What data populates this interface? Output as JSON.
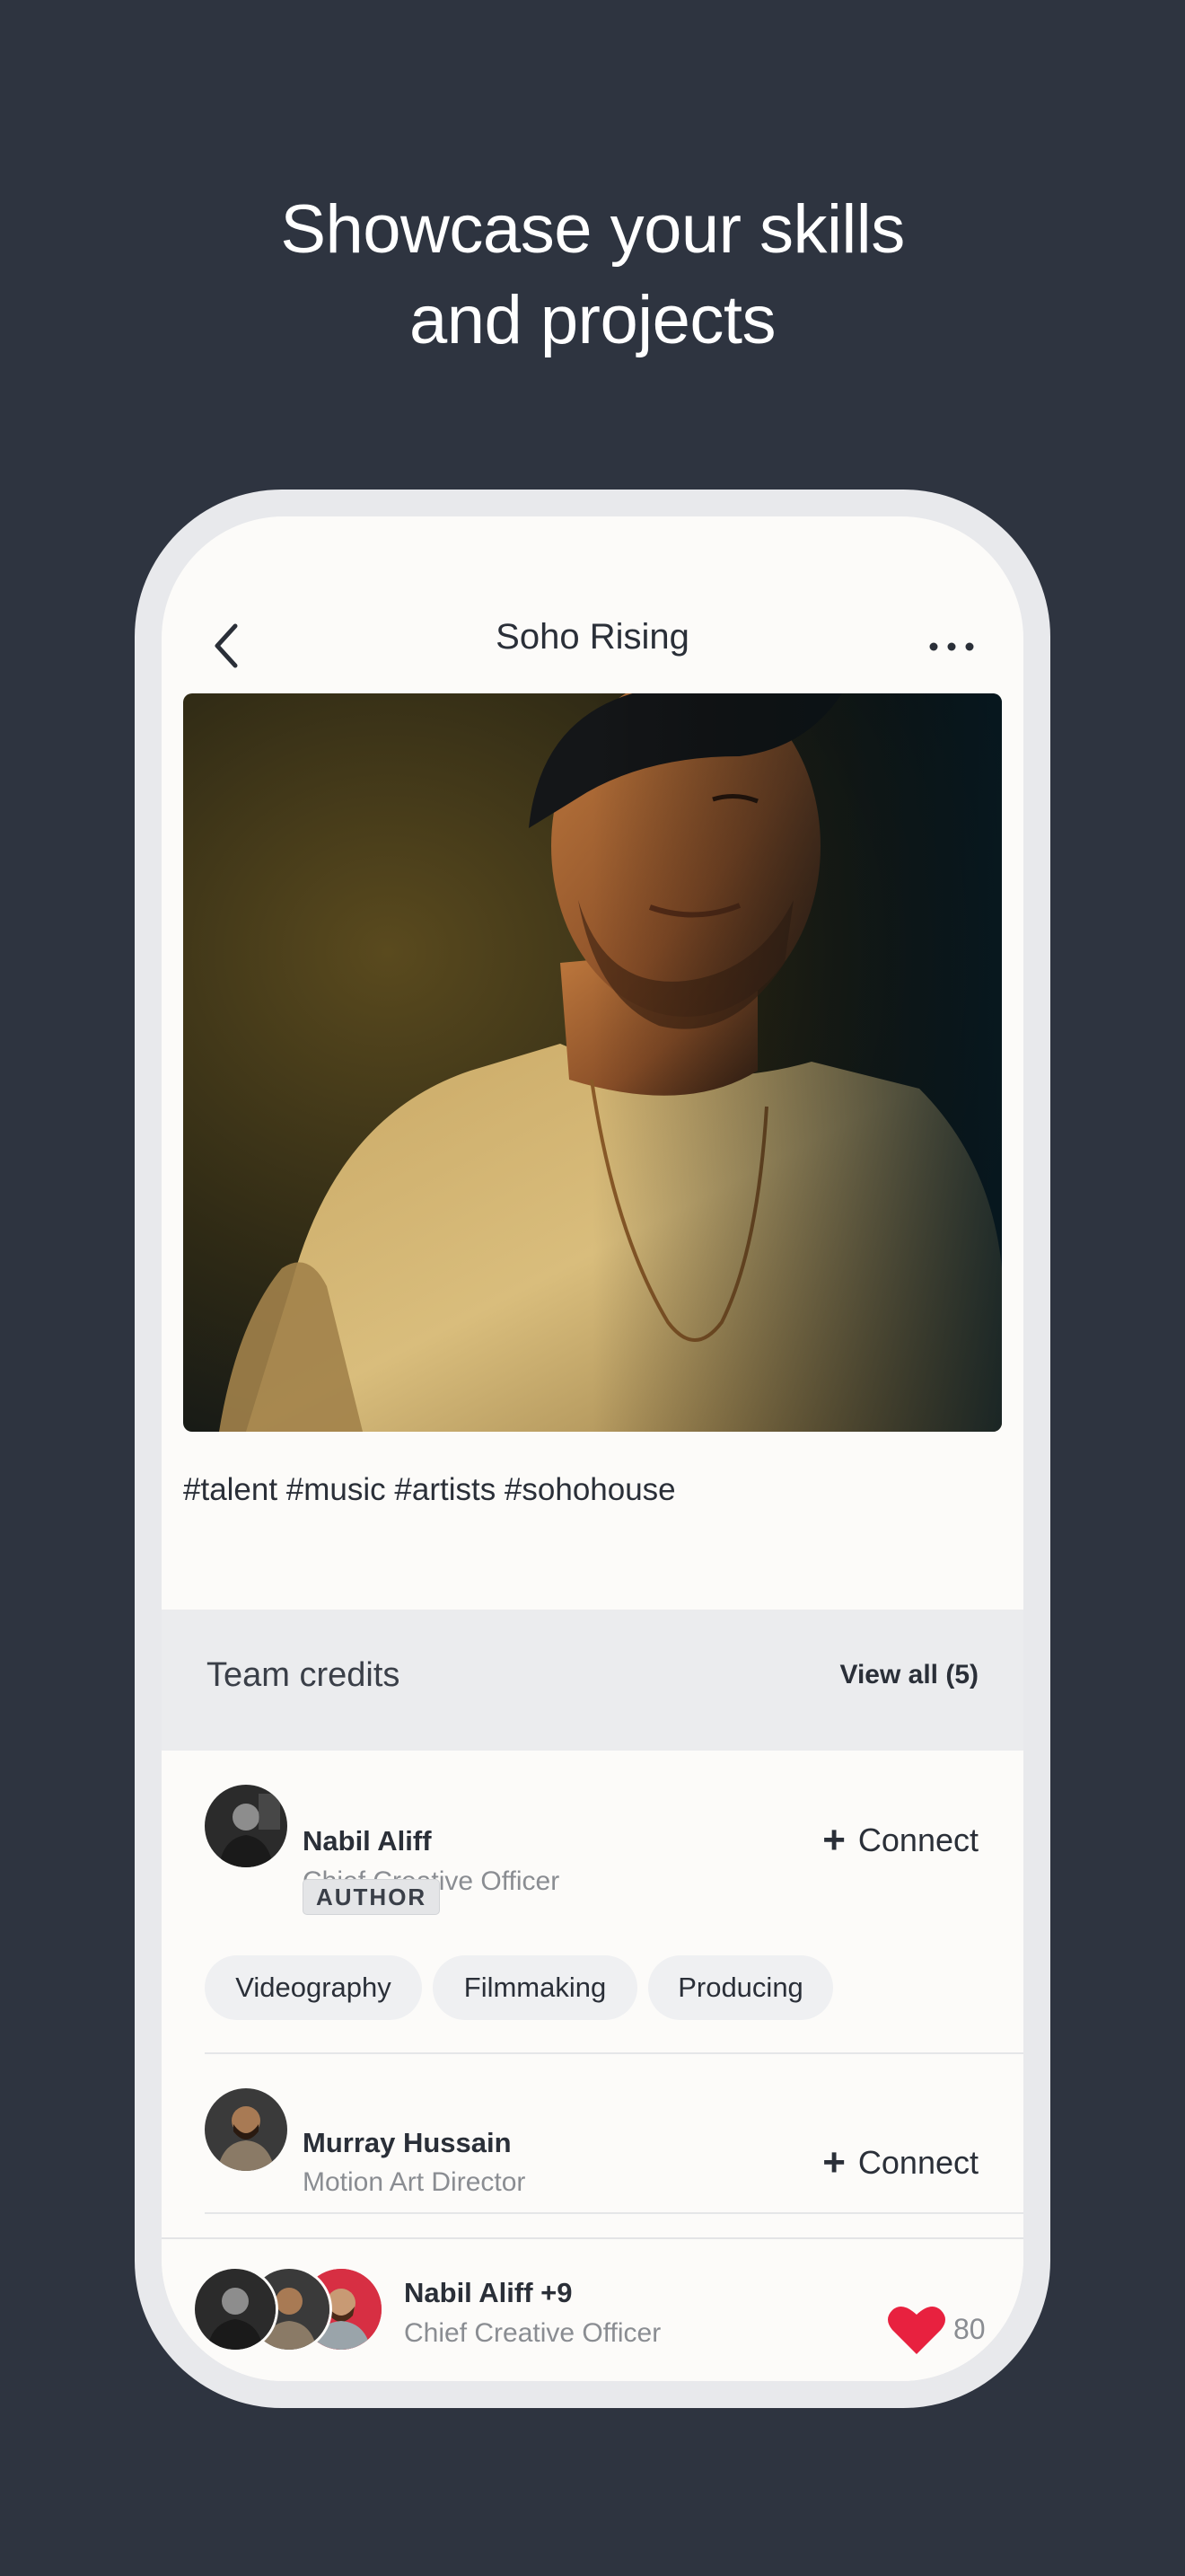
{
  "headline": {
    "line1": "Showcase your skills",
    "line2": "and projects"
  },
  "nav": {
    "title": "Soho Rising",
    "back_icon": "chevron-left-icon",
    "more_icon": "more-horizontal-icon"
  },
  "post": {
    "hashtags": "#talent #music #artists #sohohouse"
  },
  "credits": {
    "title": "Team credits",
    "view_all": "View all (5)"
  },
  "members": [
    {
      "name": "Nabil Aliff",
      "role": "Chief Creative Officer",
      "badge": "AUTHOR",
      "connect": "Connect",
      "skills": [
        "Videography",
        "Filmmaking",
        "Producing"
      ]
    },
    {
      "name": "Murray Hussain",
      "role": "Motion Art Director",
      "connect": "Connect"
    }
  ],
  "footer": {
    "name": "Nabil Aliff +9",
    "role": "Chief Creative Officer",
    "likes": "80",
    "heart_color": "#e8213f"
  },
  "colors": {
    "background": "#2e3440",
    "screen": "#fcfbf9",
    "band": "#ebecee",
    "text": "#2a2f38",
    "muted": "#8a8d92"
  }
}
